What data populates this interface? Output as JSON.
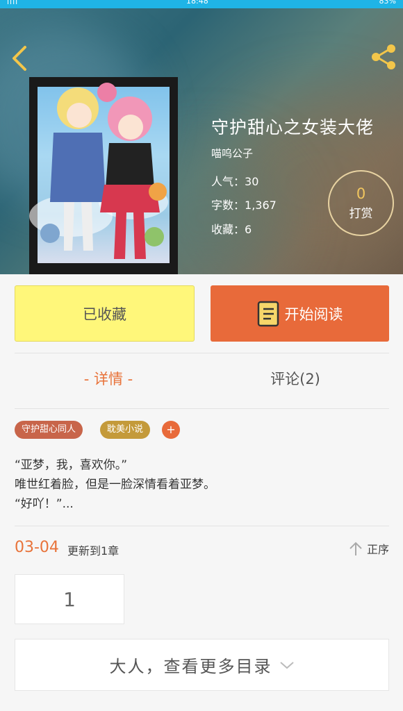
{
  "status_bar": {
    "signal": "ıllı",
    "time": "18:48",
    "battery": "83%"
  },
  "book": {
    "title": "守护甜心之女装大佬",
    "author": "喵呜公子",
    "popularity_label": "人气：",
    "popularity": "30",
    "words_label": "字数：",
    "words": "1,367",
    "favorites_label": "收藏：",
    "favorites": "6"
  },
  "tip": {
    "count": "0",
    "label": "打赏"
  },
  "actions": {
    "favorited_label": "已收藏",
    "read_label": "开始阅读"
  },
  "tabs": [
    {
      "label": "- 详情 -",
      "active": true
    },
    {
      "label": "评论(2)",
      "active": false
    }
  ],
  "tags": [
    {
      "label": "守护甜心同人",
      "color": "#c8654a"
    },
    {
      "label": "耽美小说",
      "color": "#c49a3a"
    }
  ],
  "tag_add_label": "+",
  "synopsis": [
    "“亚梦，我，喜欢你。”",
    "唯世红着脸，但是一脸深情看着亚梦。",
    "“好吖！”..."
  ],
  "update": {
    "date": "03-04",
    "text": "更新到1章",
    "sort_label": "正序"
  },
  "chapters": [
    {
      "label": "1"
    }
  ],
  "more_catalog_label": "大人，查看更多目录",
  "colors": {
    "accent": "#e86a3a",
    "favorite_button": "#fff77a",
    "status_bar": "#1fb4e6",
    "tip_gold": "#f1c65f"
  },
  "icons": [
    "back-arrow-icon",
    "share-icon",
    "book-icon",
    "sort-up-arrow-icon",
    "chevron-down-icon"
  ]
}
